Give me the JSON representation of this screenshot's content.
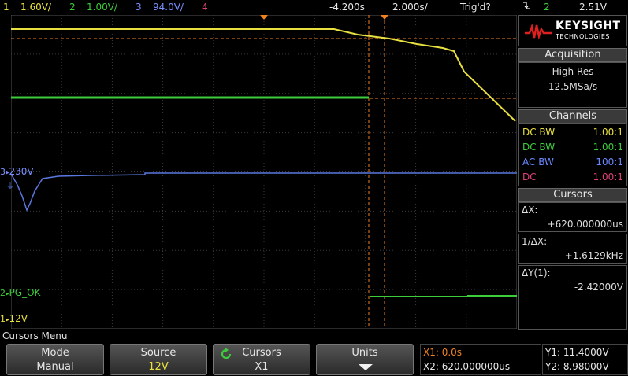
{
  "status_bar": {
    "ch1_label": "1",
    "ch1_scale": "1.60V/",
    "ch2_label": "2",
    "ch2_scale": "1.00V/",
    "ch3_label": "3",
    "ch3_scale": "94.0V/",
    "ch4_label": "4",
    "time_offset": "-4.200s",
    "timebase": "2.000s/",
    "trigger_status": "Trig'd?",
    "trigger_slope_icon": "falling-edge-icon",
    "trigger_source": "2",
    "trigger_level": "2.51V"
  },
  "waveforms": {
    "ch1_marker": "1",
    "ch1_name": "12V",
    "ch2_marker": "2",
    "ch2_name": "PG_OK",
    "ch3_marker": "3",
    "ch3_name": "230V"
  },
  "panel": {
    "brand": "KEYSIGHT",
    "brand_sub": "TECHNOLOGIES",
    "acquisition_title": "Acquisition",
    "acq_mode": "High Res",
    "acq_rate": "12.5MSa/s",
    "channels_title": "Channels",
    "channels": [
      {
        "coupling": "DC BW",
        "ratio": "1.00:1",
        "color": "#e8e040"
      },
      {
        "coupling": "DC BW",
        "ratio": "1.00:1",
        "color": "#3ccc3c"
      },
      {
        "coupling": "AC BW",
        "ratio": "100:1",
        "color": "#5a78e0"
      },
      {
        "coupling": "DC",
        "ratio": "1.00:1",
        "color": "#e0407a"
      }
    ],
    "cursors_title": "Cursors",
    "dx_label": "ΔX:",
    "dx_value": "+620.000000us",
    "inv_dx_label": "1/ΔX:",
    "inv_dx_value": "+1.6129kHz",
    "dy_label": "ΔY(1):",
    "dy_value": "-2.42000V"
  },
  "menu": {
    "title": "Cursors Menu",
    "mode_label": "Mode",
    "mode_value": "Manual",
    "source_label": "Source",
    "source_value": "12V",
    "cursors_label": "Cursors",
    "cursors_value": "X1",
    "units_label": "Units"
  },
  "readout": {
    "x1": "X1: 0.0s",
    "x2": "X2: 620.000000us",
    "y1": "Y1: 11.4000V",
    "y2": "Y2: 8.98000V"
  },
  "colors": {
    "ch1": "#e8e040",
    "ch2": "#3ccc3c",
    "ch3": "#5a78e0",
    "ch4": "#e0407a",
    "cursor": "#f08020",
    "trigger_marker": "#f08020"
  }
}
